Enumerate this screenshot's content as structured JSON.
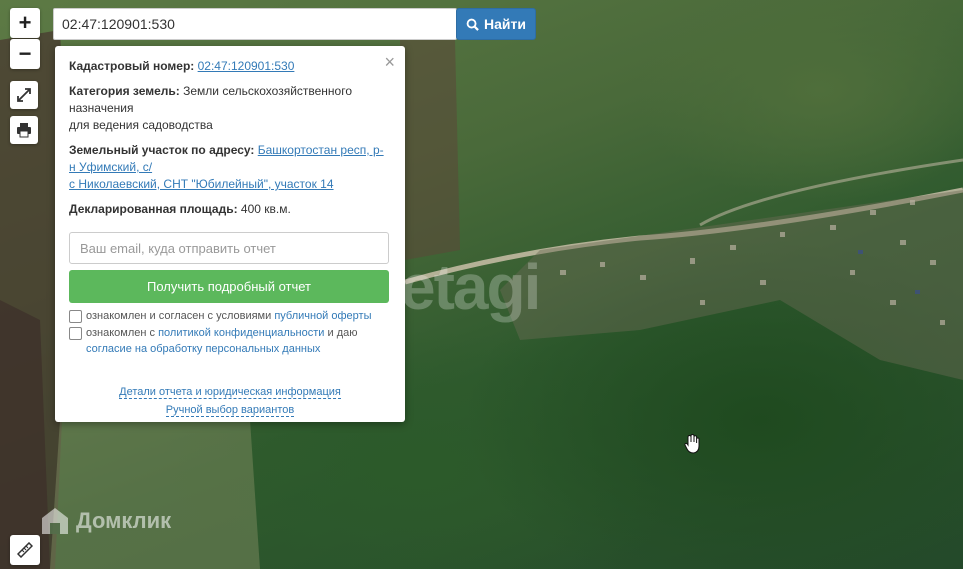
{
  "controls": {
    "zoom_in": "+",
    "zoom_out": "−",
    "fullscreen_icon": "expand-icon",
    "print_icon": "printer-icon",
    "ruler_icon": "ruler-icon"
  },
  "search": {
    "value": "02:47:120901:530",
    "button_label": "Найти",
    "button_icon": "search-icon",
    "button_color": "#337ab7"
  },
  "popup": {
    "cadastral_label": "Кадастровый номер:",
    "cadastral_value": "02:47:120901:530",
    "category_label": "Категория земель:",
    "category_value_1": "Земли сельскохозяйственного",
    "category_value_2": "назначения",
    "category_value_3": "для ведения садоводства",
    "address_label": "Земельный участок по адресу:",
    "address_value_1": "Башкортостан респ, р-",
    "address_value_2": "н Уфимский, с/",
    "address_value_3": "с Николаевский, СНТ \"Юбилейный\", участок 14",
    "area_label": "Декларированная площадь:",
    "area_value": "400 кв.м.",
    "email_placeholder": "Ваш email, куда отправить отчет",
    "report_button": "Получить подробный отчет",
    "report_button_color": "#5cb85c",
    "check1_text": "ознакомлен и согласен с условиями ",
    "check1_link": "публичной оферты",
    "check2_text": "ознакомлен с ",
    "check2_link": "политикой конфиденциальности",
    "check2_text2": " и даю",
    "check2_link2": "согласие на обработку персональных данных",
    "details_link": "Детали отчета и юридическая информация",
    "manual_link": "Ручной выбор вариантов",
    "close": "×"
  },
  "watermarks": {
    "domclick": "Домклик",
    "etagi": "etagi"
  }
}
